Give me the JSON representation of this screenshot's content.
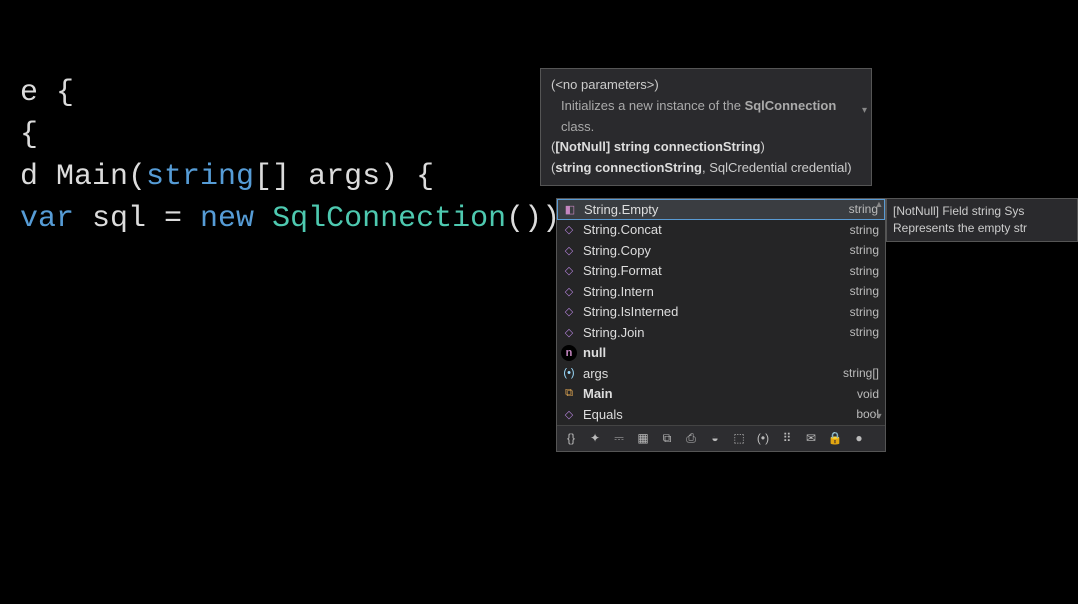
{
  "code": {
    "line1_a": "e {",
    "line2_a": "{",
    "line3_a": "d ",
    "line3_b": "Main",
    "line3_c": "(",
    "line3_d": "string",
    "line3_e": "[] ",
    "line3_f": "args",
    "line3_g": ") {",
    "line4_a": "var ",
    "line4_b": "sql ",
    "line4_c": "= ",
    "line4_d": "new ",
    "line4_e": "SqlConnection",
    "line4_f": "())"
  },
  "param_tooltip": {
    "row1": "(<no parameters>)",
    "row1_desc_a": "Initializes a new instance of the ",
    "row1_desc_b": "SqlConnection",
    "row1_desc_c": " class.",
    "row2_a": "(",
    "row2_b": "[NotNull] string connectionString",
    "row2_c": ")",
    "row3_a": "(",
    "row3_b": "string connectionString",
    "row3_c": ", SqlCredential credential)"
  },
  "completion": {
    "items": [
      {
        "icon": "prop",
        "label": "String.Empty",
        "type": "string",
        "selected": true
      },
      {
        "icon": "method",
        "label": "String.Concat",
        "type": "string"
      },
      {
        "icon": "method",
        "label": "String.Copy",
        "type": "string"
      },
      {
        "icon": "method",
        "label": "String.Format",
        "type": "string"
      },
      {
        "icon": "method",
        "label": "String.Intern",
        "type": "string"
      },
      {
        "icon": "method",
        "label": "String.IsInterned",
        "type": "string"
      },
      {
        "icon": "method",
        "label": "String.Join",
        "type": "string"
      },
      {
        "icon": "null",
        "label": "null",
        "type": "",
        "bold": true
      },
      {
        "icon": "var",
        "label": "args",
        "type": "string[]"
      },
      {
        "icon": "class",
        "label": "Main",
        "type": "void",
        "bold": true
      },
      {
        "icon": "method",
        "label": "Equals",
        "type": "bool"
      }
    ],
    "toolbar_icons": [
      "braces-icon",
      "star-icon",
      "link-icon",
      "grid-icon",
      "stack-icon",
      "printer-icon",
      "db-icon",
      "cube-icon",
      "param-icon",
      "group-icon",
      "mail-icon",
      "lock-icon",
      "null-icon"
    ]
  },
  "doc_tooltip": {
    "line1": "[NotNull] Field string Sys",
    "line2": "Represents the empty str"
  }
}
